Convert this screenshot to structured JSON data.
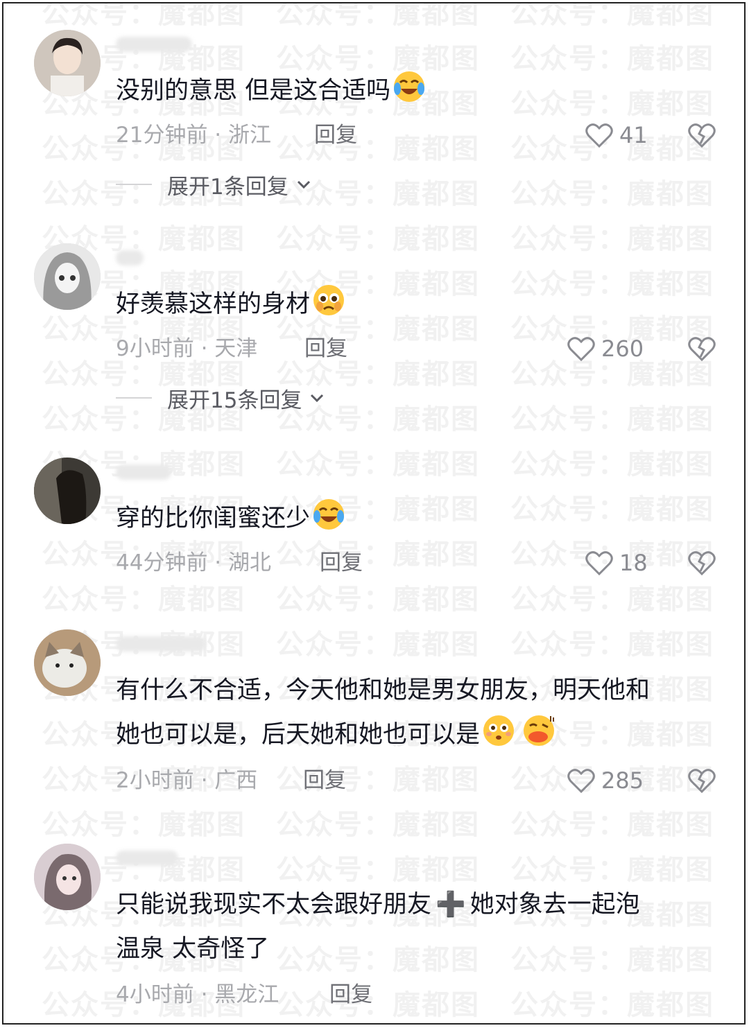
{
  "watermark_text": "公众号：魔都图",
  "comments": [
    {
      "text": "没别的意思 但是这合适吗",
      "emoji": [
        "crying-laugh-icon"
      ],
      "time_location": "21分钟前 · 浙江",
      "reply_label": "回复",
      "likes": "41",
      "expand_label": "展开1条回复"
    },
    {
      "text": "好羡慕这样的身材",
      "emoji": [
        "pleading-face-icon"
      ],
      "time_location": "9小时前 · 天津",
      "reply_label": "回复",
      "likes": "260",
      "expand_label": "展开15条回复"
    },
    {
      "text": "穿的比你闺蜜还少",
      "emoji": [
        "crying-laugh-icon"
      ],
      "time_location": "44分钟前 · 湖北",
      "reply_label": "回复",
      "likes": "18"
    },
    {
      "text_line1": "有什么不合适，今天他和她是男女朋友，明天他和",
      "text_line2": "她也可以是，后天她和她也可以是",
      "emoji": [
        "flushed-face-icon",
        "kissing-duck-icon"
      ],
      "time_location": "2小时前 · 广西",
      "reply_label": "回复",
      "likes": "285"
    },
    {
      "text_line1": "只能说我现实不太会跟好朋友",
      "plus_symbol": "➕",
      "text_line1b": "她对象去一起泡",
      "text_line2": "温泉 太奇怪了",
      "time_location": "4小时前 · 黑龙江",
      "reply_label": "回复"
    }
  ]
}
